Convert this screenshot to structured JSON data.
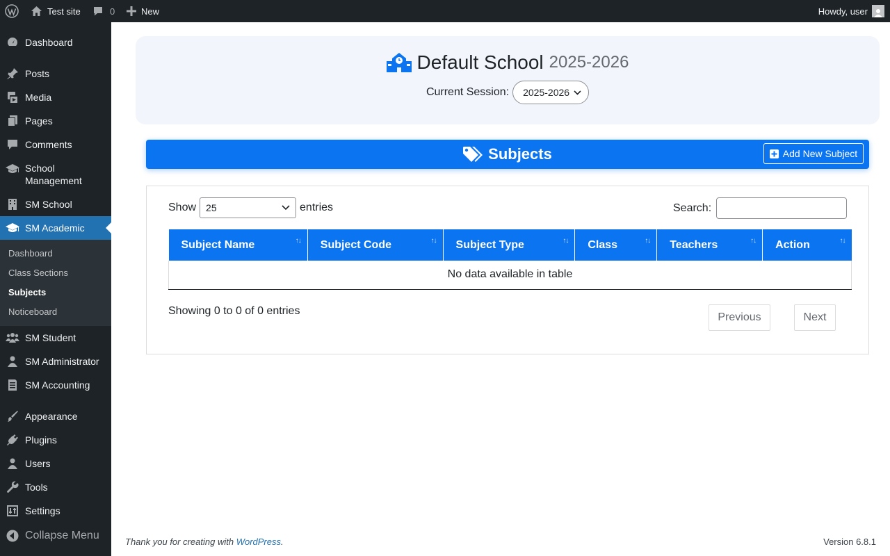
{
  "adminbar": {
    "site_name": "Test site",
    "comments_count": "0",
    "new_label": "New",
    "howdy": "Howdy, user"
  },
  "sidebar": {
    "items": [
      {
        "label": "Dashboard",
        "icon": "dashboard-icon"
      },
      {
        "label": "Posts",
        "icon": "pin-icon"
      },
      {
        "label": "Media",
        "icon": "media-icon"
      },
      {
        "label": "Pages",
        "icon": "pages-icon"
      },
      {
        "label": "Comments",
        "icon": "comment-icon"
      },
      {
        "label": "School Management",
        "icon": "graduation-cap-icon"
      },
      {
        "label": "SM School",
        "icon": "building-icon"
      },
      {
        "label": "SM Academic",
        "icon": "graduation-cap-icon",
        "current": true
      },
      {
        "label": "SM Student",
        "icon": "users-icon"
      },
      {
        "label": "SM Administrator",
        "icon": "admin-user-icon"
      },
      {
        "label": "SM Accounting",
        "icon": "ledger-icon"
      },
      {
        "label": "Appearance",
        "icon": "brush-icon"
      },
      {
        "label": "Plugins",
        "icon": "plug-icon"
      },
      {
        "label": "Users",
        "icon": "user-icon"
      },
      {
        "label": "Tools",
        "icon": "wrench-icon"
      },
      {
        "label": "Settings",
        "icon": "sliders-icon"
      }
    ],
    "submenu": [
      "Dashboard",
      "Class Sections",
      "Subjects",
      "Noticeboard"
    ],
    "submenu_active": "Subjects",
    "collapse_label": "Collapse Menu"
  },
  "school": {
    "name": "Default School",
    "year": "2025-2026",
    "session_label": "Current Session:",
    "session_value": "2025-2026"
  },
  "subjects": {
    "title": "Subjects",
    "add_button": "Add New Subject"
  },
  "datatable": {
    "show_label": "Show",
    "page_length": "25",
    "entries_label": "entries",
    "search_label": "Search:",
    "search_value": "",
    "columns": [
      "Subject Name",
      "Subject Code",
      "Subject Type",
      "Class",
      "Teachers",
      "Action"
    ],
    "empty_message": "No data available in table",
    "info": "Showing 0 to 0 of 0 entries",
    "previous_label": "Previous",
    "next_label": "Next"
  },
  "footer": {
    "thanks_prefix": "Thank you for creating with ",
    "thanks_link": "WordPress",
    "thanks_suffix": ".",
    "version": "Version 6.8.1"
  },
  "colors": {
    "accent": "#0b74f0",
    "admin_dark": "#1d2327",
    "current_menu": "#2271b1"
  }
}
